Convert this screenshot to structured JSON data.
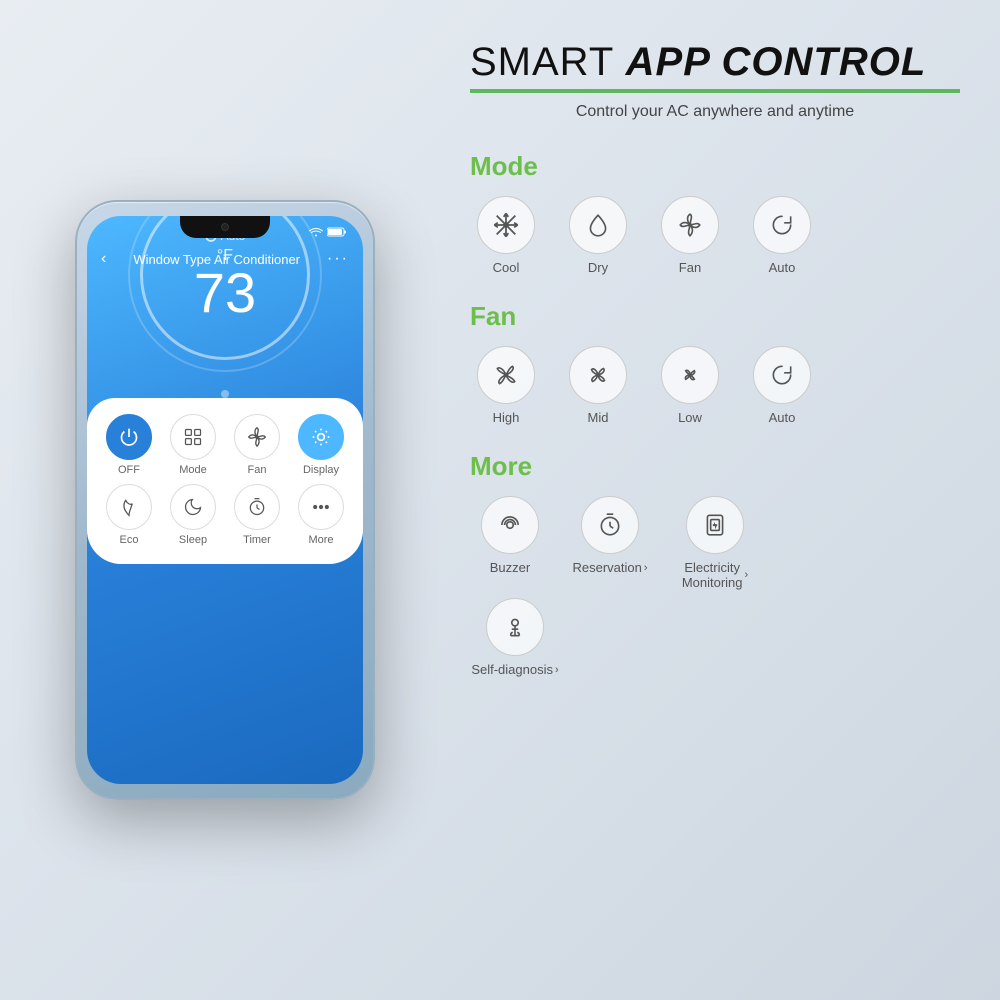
{
  "header": {
    "title": "SMART APP CONTROL",
    "title_normal": "SMART ",
    "title_bold": "APP CONTROL",
    "subtitle": "Control your AC anywhere and anytime"
  },
  "phone": {
    "app_title": "Window Type Air Conditioner",
    "mode_label": "Auto",
    "temp_unit": "°F",
    "temp_value": "73",
    "controls": [
      {
        "label": "OFF",
        "icon": "power",
        "active": "blue"
      },
      {
        "label": "Mode",
        "icon": "grid",
        "active": "none"
      },
      {
        "label": "Fan",
        "icon": "fan",
        "active": "none"
      },
      {
        "label": "Display",
        "icon": "bulb",
        "active": "lightblue"
      }
    ],
    "controls2": [
      {
        "label": "Eco",
        "icon": "leaf",
        "active": "none"
      },
      {
        "label": "Sleep",
        "icon": "moon",
        "active": "none"
      },
      {
        "label": "Timer",
        "icon": "clock",
        "active": "none"
      },
      {
        "label": "More",
        "icon": "dots",
        "active": "none"
      }
    ]
  },
  "mode_section": {
    "label": "Mode",
    "items": [
      {
        "label": "Cool",
        "icon": "❄"
      },
      {
        "label": "Dry",
        "icon": "💧"
      },
      {
        "label": "Fan",
        "icon": "✳"
      },
      {
        "label": "Auto",
        "icon": "↺"
      }
    ]
  },
  "fan_section": {
    "label": "Fan",
    "items": [
      {
        "label": "High",
        "icon": "✳"
      },
      {
        "label": "Mid",
        "icon": "✳"
      },
      {
        "label": "Low",
        "icon": "✳"
      },
      {
        "label": "Auto",
        "icon": "↺"
      }
    ]
  },
  "more_section": {
    "label": "More",
    "items": [
      {
        "label": "Buzzer",
        "has_arrow": false
      },
      {
        "label": "Reservation",
        "has_arrow": true
      },
      {
        "label": "Electricity\nMonitoring",
        "has_arrow": true
      },
      {
        "label": "Self-diagnosis",
        "has_arrow": true
      }
    ]
  }
}
